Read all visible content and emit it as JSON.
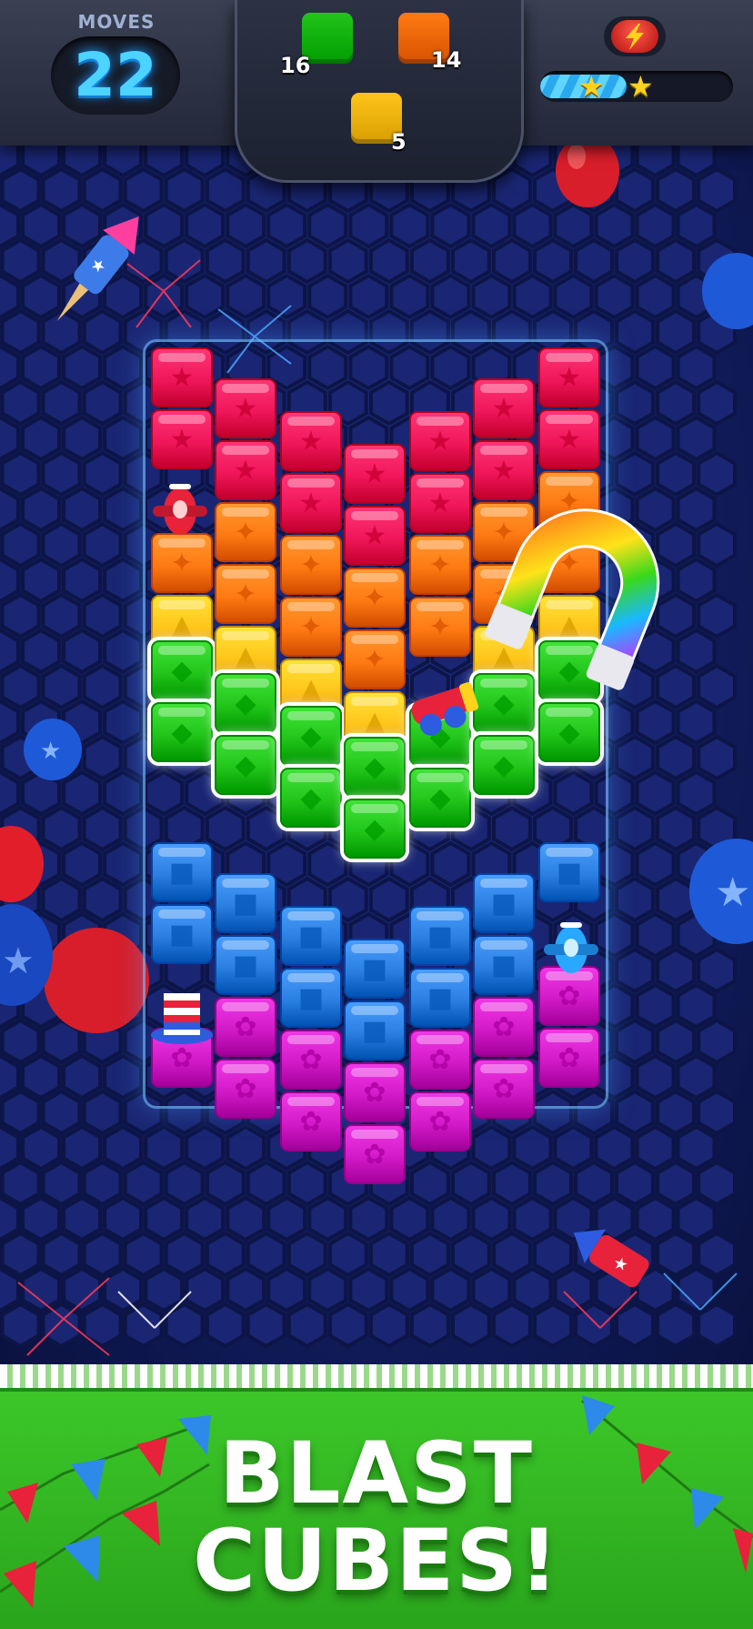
{
  "hud": {
    "moves_label": "MOVES",
    "moves_value": "22",
    "goals": [
      {
        "item": "green-cube",
        "count": "16",
        "color": "#22c51a"
      },
      {
        "item": "orange-cube",
        "count": "14",
        "color": "#ff7a12"
      },
      {
        "item": "yellow-cube",
        "count": "5",
        "color": "#ffc51a"
      }
    ],
    "energy_icon": "lightning-icon",
    "progress": 0.45,
    "stars_earned": 2
  },
  "colors": {
    "red": "#f0165a",
    "orange": "#ff7a12",
    "yellow": "#ffc51a",
    "green": "#22c51a",
    "blue": "#2b7fe0",
    "purple": "#d21ac8"
  },
  "board": {
    "columns": [
      [
        "red",
        "red",
        "special",
        "orange",
        "yellow",
        "yellow",
        "green",
        "green",
        "blue",
        "blue",
        "special",
        "purple"
      ],
      [
        "red",
        "red",
        "orange",
        "orange",
        "yellow",
        "yellow",
        "green",
        "green",
        "blue",
        "blue",
        "purple",
        "purple"
      ],
      [
        "red",
        "red",
        "orange",
        "orange",
        "yellow",
        "yellow",
        "green",
        "green",
        "blue",
        "blue",
        "purple",
        "purple"
      ],
      [
        "red",
        "red",
        "orange",
        "orange",
        "yellow",
        "yellow",
        "green",
        "green",
        "blue",
        "blue",
        "purple",
        "purple"
      ],
      [
        "red",
        "red",
        "orange",
        "orange",
        "special",
        "yellow",
        "green",
        "green",
        "blue",
        "blue",
        "purple",
        "purple"
      ],
      [
        "red",
        "red",
        "orange",
        "orange",
        "yellow",
        "yellow",
        "green",
        "green",
        "blue",
        "blue",
        "purple",
        "purple"
      ],
      [
        "red",
        "red",
        "orange",
        "orange",
        "yellow",
        "yellow",
        "green",
        "green",
        "blue",
        "special",
        "purple",
        "purple"
      ]
    ],
    "powerups": [
      "rainbow-magnet-icon",
      "airplane-icon",
      "cannon-icon",
      "firework-rocket-icon",
      "top-hat-icon"
    ]
  },
  "banner": {
    "line1": "BLAST",
    "line2": "CUBES!"
  }
}
